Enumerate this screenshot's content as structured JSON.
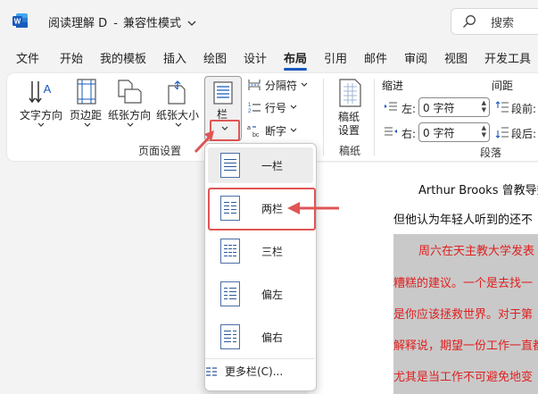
{
  "titlebar": {
    "doc_name": "阅读理解 D",
    "separator": "-",
    "compat_mode": "兼容性模式",
    "search_placeholder": "搜索"
  },
  "tabs": [
    {
      "label": "文件"
    },
    {
      "label": "开始"
    },
    {
      "label": "我的模板"
    },
    {
      "label": "插入"
    },
    {
      "label": "绘图"
    },
    {
      "label": "设计"
    },
    {
      "label": "布局",
      "active": true
    },
    {
      "label": "引用"
    },
    {
      "label": "邮件"
    },
    {
      "label": "审阅"
    },
    {
      "label": "视图"
    },
    {
      "label": "开发工具"
    }
  ],
  "ribbon": {
    "page_setup": {
      "text_direction": "文字方向",
      "margins": "页边距",
      "orientation": "纸张方向",
      "size": "纸张大小",
      "columns": "栏",
      "breaks": "分隔符",
      "line_numbers": "行号",
      "hyphenation": "断字",
      "group_label": "页面设置"
    },
    "manuscript": {
      "button": "稿纸设置",
      "button_line1": "稿纸",
      "button_line2": "设置",
      "group_label": "稿纸"
    },
    "paragraph": {
      "indent_label": "缩进",
      "spacing_label": "间距",
      "left_label": "左:",
      "left_value": "0 字符",
      "right_label": "右:",
      "right_value": "0 字符",
      "before_label": "段前:",
      "after_label": "段后:",
      "group_label": "段落"
    }
  },
  "columns_menu": {
    "items": [
      {
        "label": "一栏"
      },
      {
        "label": "两栏"
      },
      {
        "label": "三栏"
      },
      {
        "label": "偏左"
      },
      {
        "label": "偏右"
      }
    ],
    "more": "更多栏(C)..."
  },
  "document": {
    "lines": [
      "Arthur Brooks 曾教导数",
      "但他认为年轻人听到的还不",
      "周六在天主教大学发表",
      "糟糕的建议。一个是去找一",
      "是你应该拯救世界。对于第",
      "解释说，期望一份工作一直都",
      "尤其是当工作不可避免地变"
    ]
  },
  "colors": {
    "accent": "#185abd",
    "highlight": "#e05555",
    "doc_red_text": "#e02020"
  }
}
